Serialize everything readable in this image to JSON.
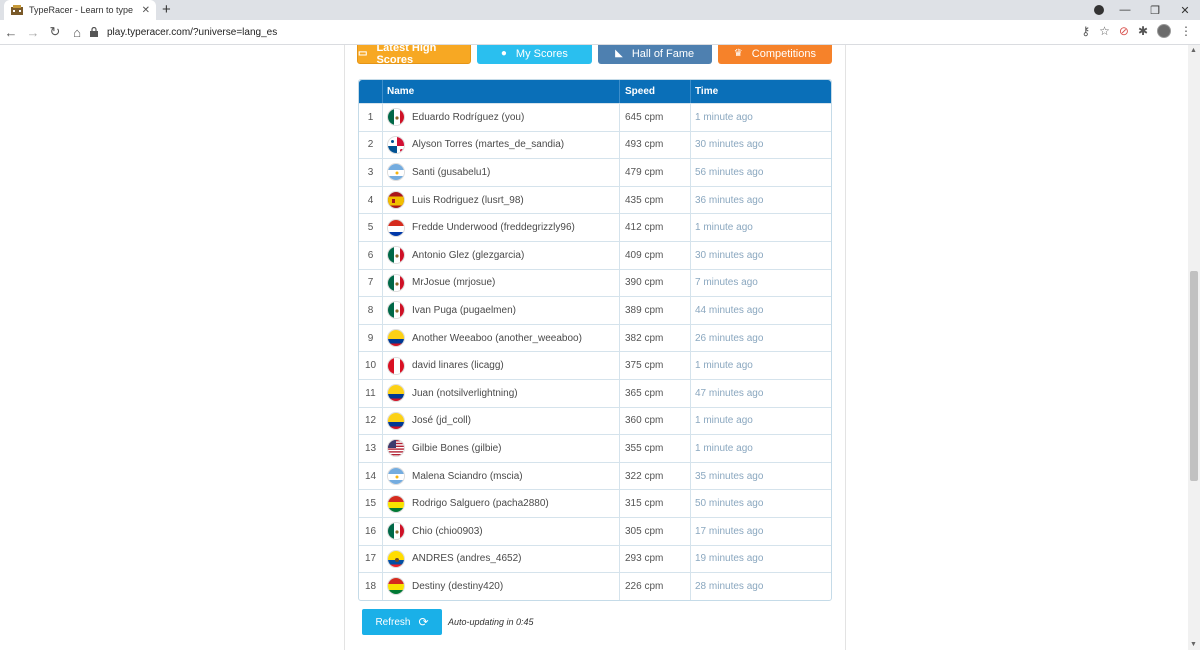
{
  "browser": {
    "tab_title": "TypeRacer - Learn to type in Spa",
    "url": "play.typeracer.com/?universe=lang_es"
  },
  "nav": {
    "tabs": [
      {
        "label": "Latest High Scores",
        "icon": "monitor-icon",
        "color": "#f7a823"
      },
      {
        "label": "My Scores",
        "icon": "user-icon",
        "color": "#2abfef"
      },
      {
        "label": "Hall of Fame",
        "icon": "thumbs-up-icon",
        "color": "#4e80b0"
      },
      {
        "label": "Competitions",
        "icon": "trophy-icon",
        "color": "#f6822a"
      }
    ]
  },
  "table": {
    "headers": {
      "name": "Name",
      "speed": "Speed",
      "time": "Time"
    },
    "rows": [
      {
        "rank": "1",
        "name": "Eduardo Rodríguez (you)",
        "speed": "645 cpm",
        "time": "1 minute ago",
        "flag": "mx"
      },
      {
        "rank": "2",
        "name": "Alyson Torres (martes_de_sandia)",
        "speed": "493 cpm",
        "time": "30 minutes ago",
        "flag": "pa"
      },
      {
        "rank": "3",
        "name": "Santi (gusabelu1)",
        "speed": "479 cpm",
        "time": "56 minutes ago",
        "flag": "ar"
      },
      {
        "rank": "4",
        "name": "Luis Rodriguez (lusrt_98)",
        "speed": "435 cpm",
        "time": "36 minutes ago",
        "flag": "es"
      },
      {
        "rank": "5",
        "name": "Fredde Underwood (freddegrizzly96)",
        "speed": "412 cpm",
        "time": "1 minute ago",
        "flag": "py"
      },
      {
        "rank": "6",
        "name": "Antonio Glez (glezgarcia)",
        "speed": "409 cpm",
        "time": "30 minutes ago",
        "flag": "mx"
      },
      {
        "rank": "7",
        "name": "MrJosue (mrjosue)",
        "speed": "390 cpm",
        "time": "7 minutes ago",
        "flag": "mx"
      },
      {
        "rank": "8",
        "name": "Ivan Puga (pugaelmen)",
        "speed": "389 cpm",
        "time": "44 minutes ago",
        "flag": "mx"
      },
      {
        "rank": "9",
        "name": "Another Weeaboo (another_weeaboo)",
        "speed": "382 cpm",
        "time": "26 minutes ago",
        "flag": "co"
      },
      {
        "rank": "10",
        "name": "david linares (licagg)",
        "speed": "375 cpm",
        "time": "1 minute ago",
        "flag": "pe"
      },
      {
        "rank": "11",
        "name": "Juan (notsilverlightning)",
        "speed": "365 cpm",
        "time": "47 minutes ago",
        "flag": "co"
      },
      {
        "rank": "12",
        "name": "José (jd_coll)",
        "speed": "360 cpm",
        "time": "1 minute ago",
        "flag": "co"
      },
      {
        "rank": "13",
        "name": "Gilbie Bones (gilbie)",
        "speed": "355 cpm",
        "time": "1 minute ago",
        "flag": "us"
      },
      {
        "rank": "14",
        "name": "Malena Sciandro (mscia)",
        "speed": "322 cpm",
        "time": "35 minutes ago",
        "flag": "ar"
      },
      {
        "rank": "15",
        "name": "Rodrigo Salguero (pacha2880)",
        "speed": "315 cpm",
        "time": "50 minutes ago",
        "flag": "bo"
      },
      {
        "rank": "16",
        "name": "Chio (chio0903)",
        "speed": "305 cpm",
        "time": "17 minutes ago",
        "flag": "mx"
      },
      {
        "rank": "17",
        "name": "ANDRES (andres_4652)",
        "speed": "293 cpm",
        "time": "19 minutes ago",
        "flag": "ec"
      },
      {
        "rank": "18",
        "name": "Destiny (destiny420)",
        "speed": "226 cpm",
        "time": "28 minutes ago",
        "flag": "bo"
      }
    ]
  },
  "footer": {
    "refresh_label": "Refresh",
    "auto_update_text": "Auto-updating in 0:45"
  }
}
